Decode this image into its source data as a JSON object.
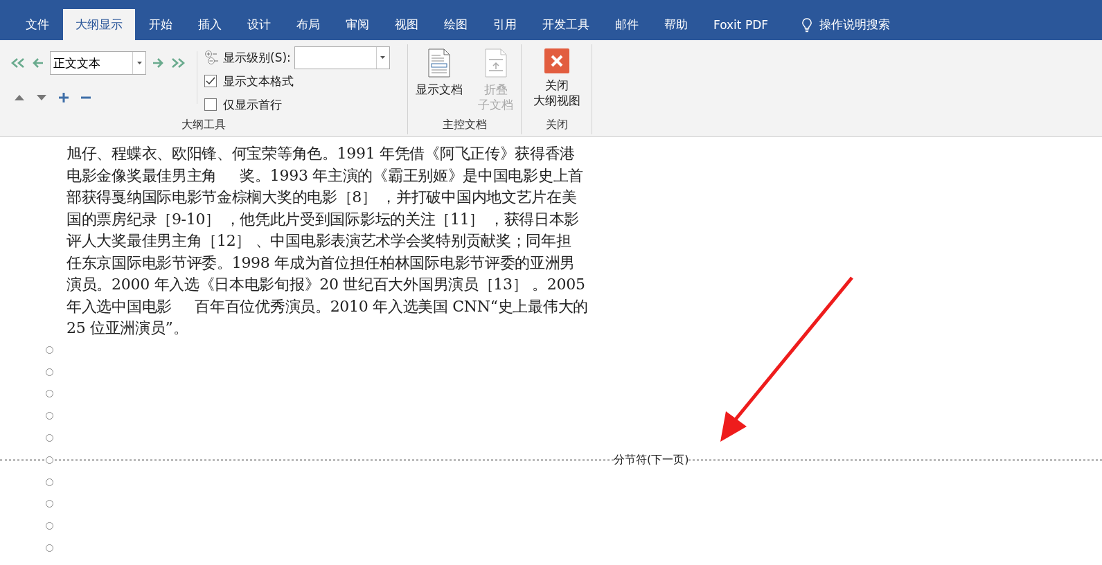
{
  "menu_tabs": [
    {
      "label": "文件",
      "selected": false
    },
    {
      "label": "大纲显示",
      "selected": true
    },
    {
      "label": "开始",
      "selected": false
    },
    {
      "label": "插入",
      "selected": false
    },
    {
      "label": "设计",
      "selected": false
    },
    {
      "label": "布局",
      "selected": false
    },
    {
      "label": "审阅",
      "selected": false
    },
    {
      "label": "视图",
      "selected": false
    },
    {
      "label": "绘图",
      "selected": false
    },
    {
      "label": "引用",
      "selected": false
    },
    {
      "label": "开发工具",
      "selected": false
    },
    {
      "label": "邮件",
      "selected": false
    },
    {
      "label": "帮助",
      "selected": false
    },
    {
      "label": "Foxit PDF",
      "selected": false
    }
  ],
  "tell_me": {
    "label": "操作说明搜索"
  },
  "outline_tools": {
    "label": "大纲工具",
    "level_select": {
      "value": "正文文本"
    },
    "show_level": {
      "label": "显示级别(S):"
    },
    "checkboxes": [
      {
        "label": "显示文本格式",
        "checked": true
      },
      {
        "label": "仅显示首行",
        "checked": false
      }
    ]
  },
  "master_document": {
    "label": "主控文档",
    "buttons": [
      {
        "kind": "show",
        "lines": [
          "显示文档"
        ],
        "disabled": false
      },
      {
        "kind": "collapse",
        "lines": [
          "折叠",
          "子文档"
        ],
        "disabled": true
      }
    ]
  },
  "close_group": {
    "label": "关闭",
    "button": {
      "lines": [
        "关闭",
        "大纲视图"
      ]
    }
  },
  "document": {
    "paragraph_lines": [
      "旭仔、程蝶衣、欧阳锋、何宝荣等角色。1991 年凭借《阿飞正传》获得香港",
      "电影金像奖最佳男主角     奖。1993 年主演的《霸王别姬》是中国电影史上首",
      "部获得戛纳国际电影节金棕榈大奖的电影［8］ ，并打破中国内地文艺片在美",
      "国的票房纪录［9-10］ ，他凭此片受到国际影坛的关注［11］ ，获得日本影",
      "评人大奖最佳男主角［12］ 、中国电影表演艺术学会奖特别贡献奖；同年担",
      "任东京国际电影节评委。1998 年成为首位担任柏林国际电影节评委的亚洲男",
      "演员。2000 年入选《日本电影旬报》20 世纪百大外国男演员［13］ 。2005",
      "年入选中国电影     百年百位优秀演员。2010 年入选美国 CNN“史上最伟大的",
      "25 位亚洲演员”。"
    ],
    "outline_items": [
      {
        "kind": "empty"
      },
      {
        "kind": "empty"
      },
      {
        "kind": "empty"
      },
      {
        "kind": "empty"
      },
      {
        "kind": "empty"
      },
      {
        "kind": "section_break",
        "label": "分节符(下一页)"
      },
      {
        "kind": "empty"
      },
      {
        "kind": "empty"
      },
      {
        "kind": "empty"
      },
      {
        "kind": "empty"
      }
    ]
  }
}
